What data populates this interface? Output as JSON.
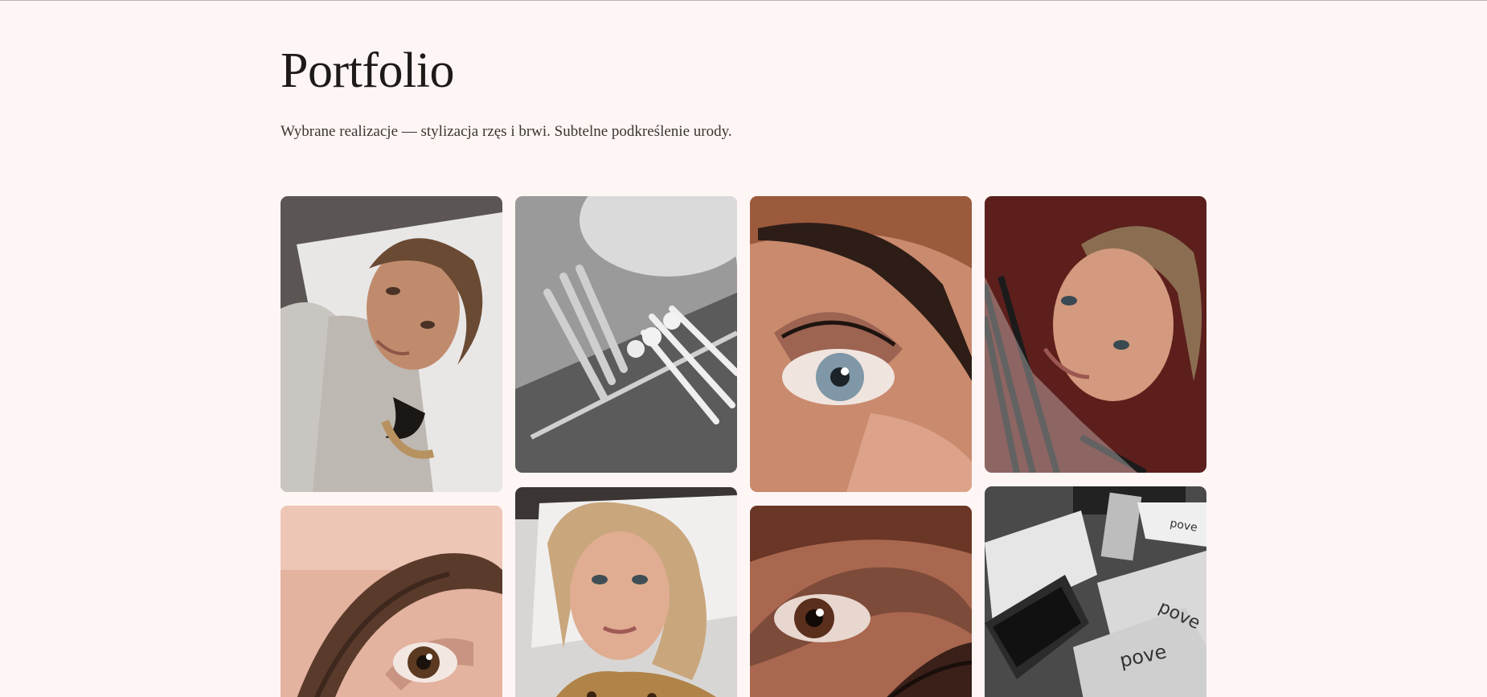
{
  "page": {
    "title": "Portfolio",
    "subtitle": "Wybrane realizacje — stylizacja rzęs i brwi. Subtelne podkreślenie urody."
  },
  "gallery": {
    "items": [
      {
        "label": "client-portrait-gray-sweater",
        "tone": "#b49a86"
      },
      {
        "label": "lash-brushes-monochrome",
        "tone": "#8d8d8d"
      },
      {
        "label": "eye-brow-closeup-blue-eye",
        "tone": "#b87a5c"
      },
      {
        "label": "client-portrait-striped-shirt",
        "tone": "#6b2a25"
      },
      {
        "label": "brow-lamination-closeup",
        "tone": "#d4a28c"
      },
      {
        "label": "client-portrait-leopard-top",
        "tone": "#caa68a"
      },
      {
        "label": "eye-closeup-brown-eye",
        "tone": "#9a5a44"
      },
      {
        "label": "lash-products-pove-boxes",
        "tone": "#9b9b9b"
      }
    ],
    "brand_text": "pove"
  },
  "colors": {
    "background": "#fdf6f4",
    "title": "#1e1a18",
    "subtitle": "#3b3431"
  }
}
